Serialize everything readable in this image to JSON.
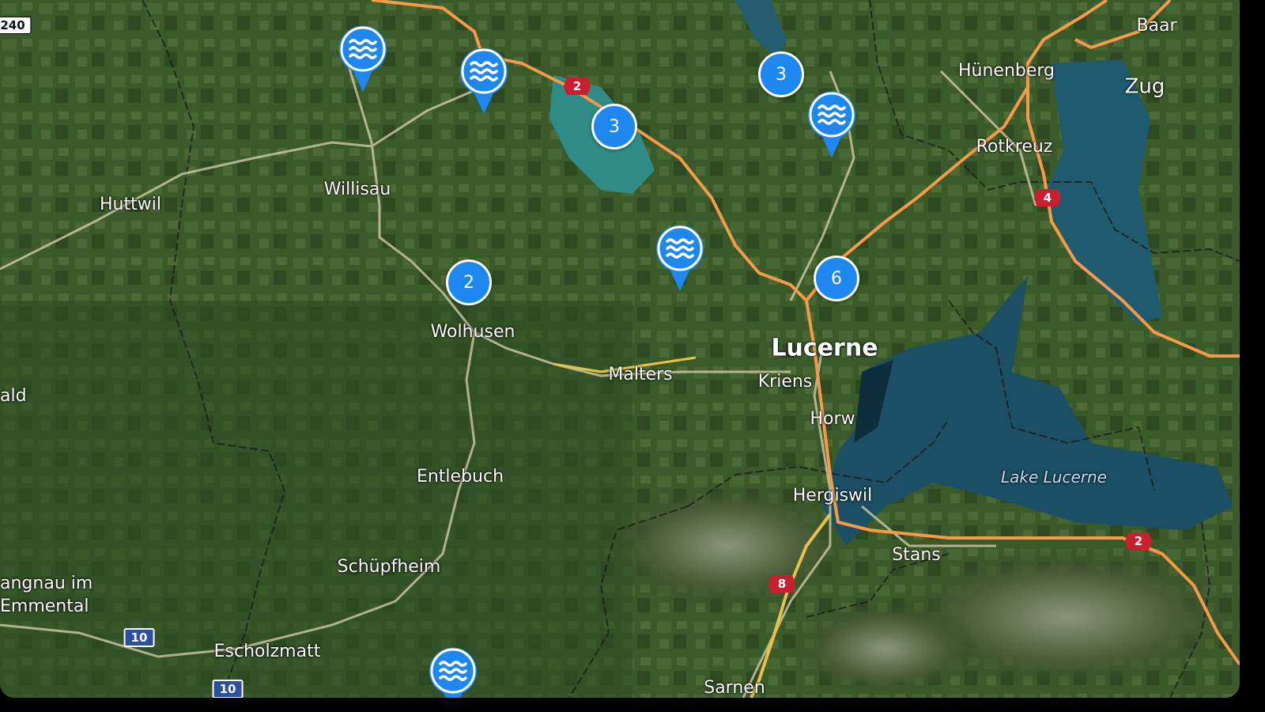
{
  "map": {
    "labels": [
      {
        "id": "huttwil",
        "text": "Huttwil"
      },
      {
        "id": "willisau",
        "text": "Willisau"
      },
      {
        "id": "wolhusen",
        "text": "Wolhusen"
      },
      {
        "id": "malters",
        "text": "Malters"
      },
      {
        "id": "lucerne",
        "text": "Lucerne"
      },
      {
        "id": "kriens",
        "text": "Kriens"
      },
      {
        "id": "horw",
        "text": "Horw"
      },
      {
        "id": "hergiswil",
        "text": "Hergiswil"
      },
      {
        "id": "stans",
        "text": "Stans"
      },
      {
        "id": "sarnen",
        "text": "Sarnen"
      },
      {
        "id": "entlebuch",
        "text": "Entlebuch"
      },
      {
        "id": "schupfheim",
        "text": "Schüpfheim"
      },
      {
        "id": "escholzmatt",
        "text": "Escholzmatt"
      },
      {
        "id": "langnau1",
        "text": "angnau im"
      },
      {
        "id": "langnau2",
        "text": "Emmental"
      },
      {
        "id": "ald",
        "text": "ald"
      },
      {
        "id": "hunenberg",
        "text": "Hünenberg"
      },
      {
        "id": "rotkreuz",
        "text": "Rotkreuz"
      },
      {
        "id": "baar",
        "text": "Baar"
      },
      {
        "id": "zug",
        "text": "Zug"
      },
      {
        "id": "lake_lucerne",
        "text": "Lake Lucerne"
      }
    ],
    "road_shields": [
      {
        "id": "a240",
        "text": "240",
        "style": "white"
      },
      {
        "id": "a2_n",
        "text": "2",
        "style": "red"
      },
      {
        "id": "a4",
        "text": "4",
        "style": "red"
      },
      {
        "id": "a2_e",
        "text": "2",
        "style": "red"
      },
      {
        "id": "a8",
        "text": "8",
        "style": "red"
      },
      {
        "id": "r10_a",
        "text": "10",
        "style": "blue"
      },
      {
        "id": "r10_b",
        "text": "10",
        "style": "blue"
      }
    ],
    "clusters": [
      {
        "id": "c1",
        "count": "3"
      },
      {
        "id": "c2",
        "count": "3"
      },
      {
        "id": "c3",
        "count": "2"
      },
      {
        "id": "c4",
        "count": "6"
      }
    ],
    "pins": [
      {
        "id": "p1",
        "icon": "water-waves-icon"
      },
      {
        "id": "p2",
        "icon": "water-waves-icon"
      },
      {
        "id": "p3",
        "icon": "water-waves-icon"
      },
      {
        "id": "p4",
        "icon": "water-waves-icon"
      },
      {
        "id": "p5",
        "icon": "water-waves-icon"
      }
    ],
    "colors": {
      "marker": "#1e88f0",
      "highway": "#f59a4a",
      "main_road": "#d9d3b0",
      "water": "#1f5a6e",
      "shield_red": "#c8202f",
      "shield_blue": "#2d4fa0"
    }
  }
}
